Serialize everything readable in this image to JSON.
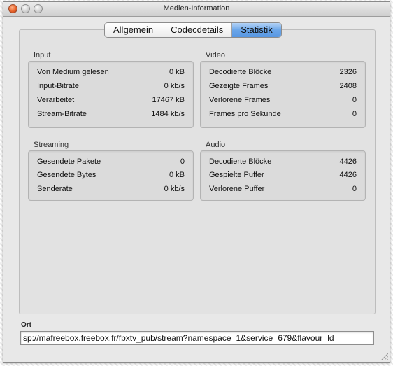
{
  "window": {
    "title": "Medien-Information"
  },
  "tabs": [
    {
      "label": "Allgemein",
      "active": false
    },
    {
      "label": "Codecdetails",
      "active": false
    },
    {
      "label": "Statistik",
      "active": true
    }
  ],
  "sections": {
    "input": {
      "label": "Input",
      "rows": [
        {
          "key": "Von Medium gelesen",
          "value": "0 kB"
        },
        {
          "key": "Input-Bitrate",
          "value": "0 kb/s"
        },
        {
          "key": "Verarbeitet",
          "value": "17467 kB"
        },
        {
          "key": "Stream-Bitrate",
          "value": "1484 kb/s"
        }
      ]
    },
    "video": {
      "label": "Video",
      "rows": [
        {
          "key": "Decodierte Blöcke",
          "value": "2326"
        },
        {
          "key": "Gezeigte Frames",
          "value": "2408"
        },
        {
          "key": "Verlorene Frames",
          "value": "0"
        },
        {
          "key": "Frames pro Sekunde",
          "value": "0"
        }
      ]
    },
    "streaming": {
      "label": "Streaming",
      "rows": [
        {
          "key": "Gesendete Pakete",
          "value": "0"
        },
        {
          "key": "Gesendete Bytes",
          "value": "0 kB"
        },
        {
          "key": "Senderate",
          "value": "0 kb/s"
        }
      ]
    },
    "audio": {
      "label": "Audio",
      "rows": [
        {
          "key": "Decodierte Blöcke",
          "value": "4426"
        },
        {
          "key": "Gespielte Puffer",
          "value": "4426"
        },
        {
          "key": "Verlorene Puffer",
          "value": "0"
        }
      ]
    }
  },
  "ort": {
    "label": "Ort",
    "value": "sp://mafreebox.freebox.fr/fbxtv_pub/stream?namespace=1&service=679&flavour=ld"
  }
}
